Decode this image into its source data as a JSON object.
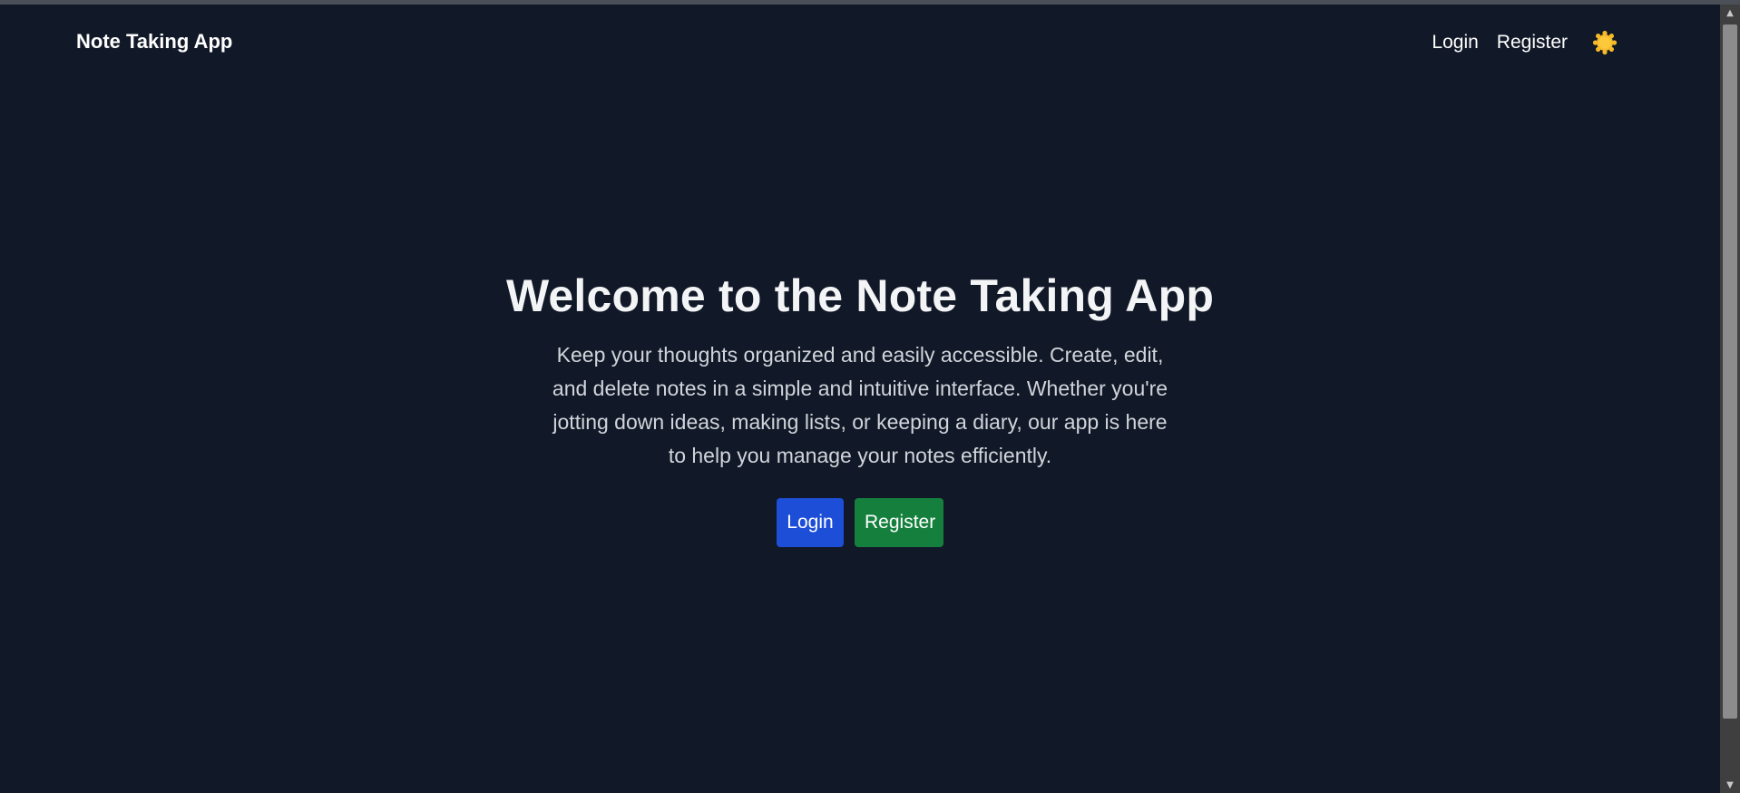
{
  "navbar": {
    "brand": "Note Taking App",
    "links": [
      {
        "label": "Login"
      },
      {
        "label": "Register"
      }
    ],
    "theme_icon": "sun-icon"
  },
  "hero": {
    "title": "Welcome to the Note Taking App",
    "description": "Keep your thoughts organized and easily accessible. Create, edit, and delete notes in a simple and intuitive interface. Whether you're jotting down ideas, making lists, or keeping a diary, our app is here to help you manage your notes efficiently.",
    "login_button": "Login",
    "register_button": "Register"
  },
  "colors": {
    "background": "#111827",
    "login_button": "#1d4ed8",
    "register_button": "#15803d",
    "sun": "#f7b928"
  }
}
